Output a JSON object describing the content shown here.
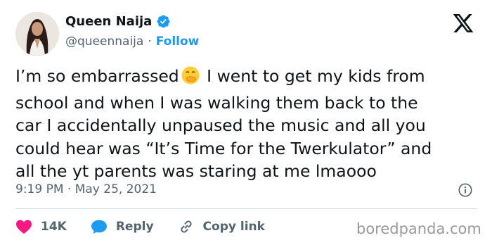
{
  "author": {
    "display_name": "Queen Naija",
    "handle": "@queennaija",
    "separator": "·",
    "follow_label": "Follow",
    "verified_icon": "verified-badge-icon"
  },
  "tweet": {
    "text": "I’m so embarrassed [emoji] I went to get my kids from school and when I was walking them back to the car I accidentally unpaused the music and all you could hear was “It’s Time for the Twerkulator” and all the yt parents was staring at me lmaooo",
    "text_before_emoji": "I’m so embarrassed",
    "emoji": "face-with-hand-over-mouth-emoji",
    "text_after_emoji": " I went to get my kids from\nschool and when I was walking them back to the\ncar I accidentally unpaused the music and all you\ncould hear was “It’s Time for the Twerkulator” and\nall the yt parents was staring at me lmaooo",
    "timestamp": "9:19 PM · May 25, 2021"
  },
  "actions": {
    "like_count": "14K",
    "reply_label": "Reply",
    "copy_link_label": "Copy link"
  },
  "watermark": "boredpanda.com",
  "colors": {
    "accent": "#1d9bf0",
    "like": "#f91880",
    "secondary_text": "#536471"
  }
}
